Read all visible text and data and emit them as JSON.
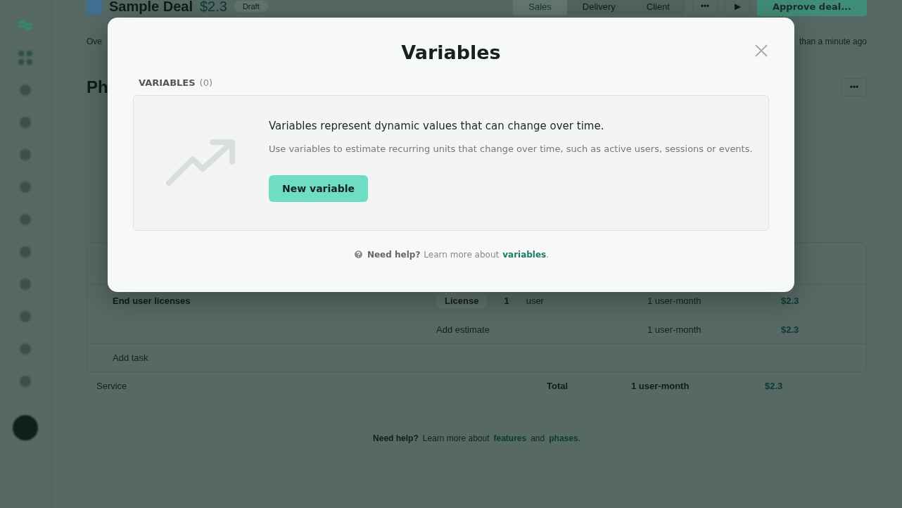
{
  "background": {
    "header": {
      "title": "Sample Deal",
      "amount": "$2.3",
      "badge": "Draft",
      "tabs": [
        {
          "label": "Sales",
          "selected": true
        },
        {
          "label": "Delivery",
          "selected": false
        },
        {
          "label": "Client",
          "selected": false
        }
      ],
      "more_button": "•••",
      "run_button": "▶",
      "approve_button": "Approve deal..."
    },
    "subheader": {
      "left": "Ove",
      "right": "than a minute ago"
    },
    "section_title": "Ph",
    "section_more_button": "•••",
    "task": {
      "name": "End user licenses",
      "estimate_tag": "License",
      "quantity": "1",
      "unit": "user",
      "rows": [
        {
          "kind": "estimate",
          "duration": "1 user-month",
          "price": "$2.3"
        },
        {
          "kind": "add",
          "label": "Add estimate",
          "duration": "1 user-month",
          "price": "$2.3"
        }
      ]
    },
    "add_task": "Add task",
    "footer": {
      "add_service": "Service",
      "total_label": "Total",
      "total_duration": "1 user-month",
      "total_price": "$2.3"
    },
    "help": {
      "lead": "Need help?",
      "text": "Learn more about",
      "link_1": "features",
      "joiner": "and",
      "link_2": "phases",
      "end": "."
    }
  },
  "modal": {
    "title": "Variables",
    "section_label": "VARIABLES",
    "count": "(0)",
    "empty_state": {
      "heading": "Variables represent dynamic values that can change over time.",
      "description": "Use variables to estimate recurring units that change over time, such as active users, sessions or events.",
      "button": "New variable"
    },
    "help": {
      "lead": "Need help?",
      "text": "Learn more about",
      "link": "variables",
      "end": "."
    }
  }
}
